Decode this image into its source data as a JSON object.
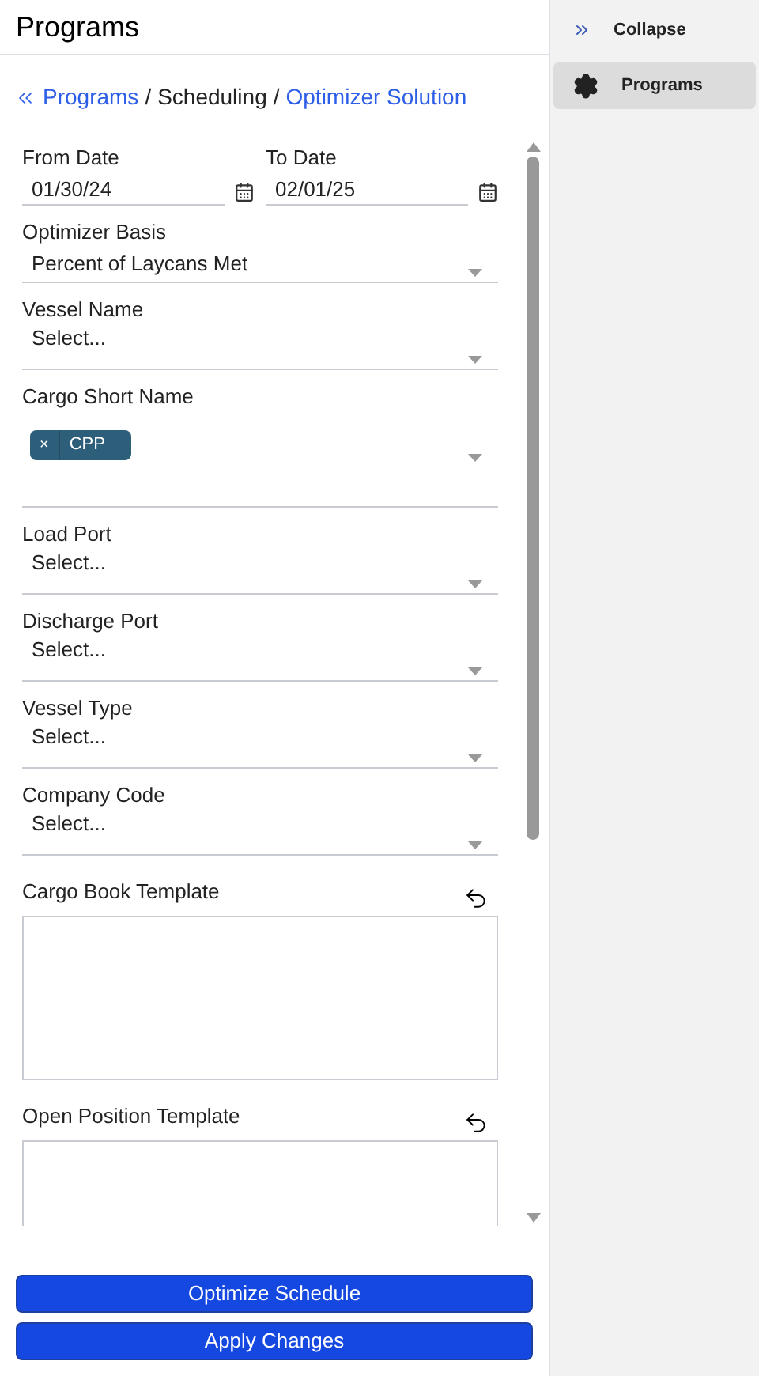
{
  "header": {
    "title": "Programs"
  },
  "breadcrumb": [
    {
      "label": "Programs",
      "kind": "link"
    },
    {
      "label": "/",
      "kind": "separator"
    },
    {
      "label": "Scheduling",
      "kind": "current"
    },
    {
      "label": "/",
      "kind": "separator"
    },
    {
      "label": "Optimizer Solution",
      "kind": "link"
    }
  ],
  "date_fields": [
    {
      "label": "From Date",
      "value": "01/30/24"
    },
    {
      "label": "To Date",
      "value": "02/01/25"
    }
  ],
  "fields": [
    {
      "kind": "select",
      "label": "Optimizer Basis",
      "value": "Percent of Laycans Met"
    },
    {
      "kind": "select",
      "label": "Vessel Name",
      "placeholder": "Select..."
    },
    {
      "kind": "multiselect",
      "label": "Cargo Short Name",
      "tags": [
        {
          "remove": "×",
          "label": "CPP"
        }
      ]
    },
    {
      "kind": "select",
      "label": "Load Port",
      "placeholder": "Select..."
    },
    {
      "kind": "select",
      "label": "Discharge Port",
      "placeholder": "Select..."
    },
    {
      "kind": "select",
      "label": "Vessel Type",
      "placeholder": "Select..."
    },
    {
      "kind": "select",
      "label": "Company Code",
      "placeholder": "Select..."
    },
    {
      "kind": "textarea",
      "label": "Cargo Book Template"
    },
    {
      "kind": "textarea",
      "label": "Open Position Template"
    }
  ],
  "buttons": [
    "Optimize Schedule",
    "Apply Changes"
  ],
  "sidebar": {
    "items": [
      {
        "label": "Collapse",
        "kind": "collapse",
        "selected": false
      },
      {
        "label": "Programs",
        "kind": "gear",
        "selected": true
      }
    ]
  }
}
